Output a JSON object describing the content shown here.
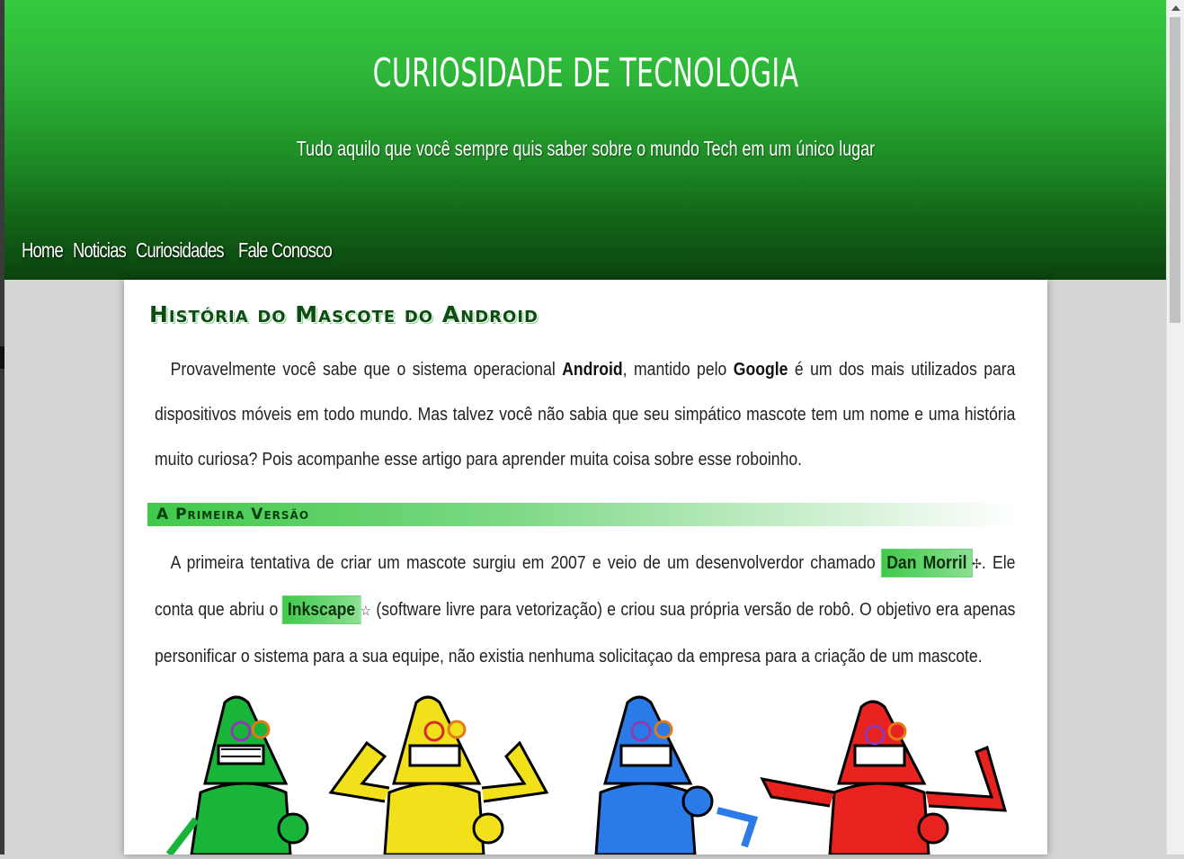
{
  "header": {
    "title": "CURIOSIDADE DE TECNOLOGIA",
    "subtitle": "Tudo aquilo que você sempre quis saber sobre o mundo Tech em um único lugar"
  },
  "nav": {
    "items": [
      {
        "label": "Home"
      },
      {
        "label": "Noticias"
      },
      {
        "label": "Curiosidades"
      },
      {
        "label": "Fale Conosco"
      }
    ]
  },
  "article": {
    "title": "História do Mascote do Android",
    "intro": {
      "t1": "Provavelmente você sabe que o sistema operacional ",
      "b1": "Android",
      "t2": ", mantido pelo ",
      "b2": "Google",
      "t3": " é um dos mais utilizados para dispositivos móveis em todo mundo. Mas talvez você não sabia que seu simpático mascote tem um nome e uma história muito curiosa? Pois acompanhe esse artigo para aprender muita coisa sobre esse roboinho."
    },
    "section1": {
      "heading": "A Primeira Versão",
      "t1": "A primeira tentativa de criar um mascote surgiu em 2007 e veio de um desenvolverdor chamado ",
      "person": "Dan Morril",
      "t2": ". Ele conta que abriu o ",
      "software": "Inkscape",
      "t3": " (software livre para vetorização) e criou sua própria versão de robô. O objetivo era apenas personificar o sistema para a sua equipe, não existia nenhuma solicitaçao da empresa para a criação de um mascote."
    }
  },
  "robots": {
    "colors": [
      "#19b53a",
      "#f2e11a",
      "#2a7be8",
      "#e8231f"
    ]
  }
}
